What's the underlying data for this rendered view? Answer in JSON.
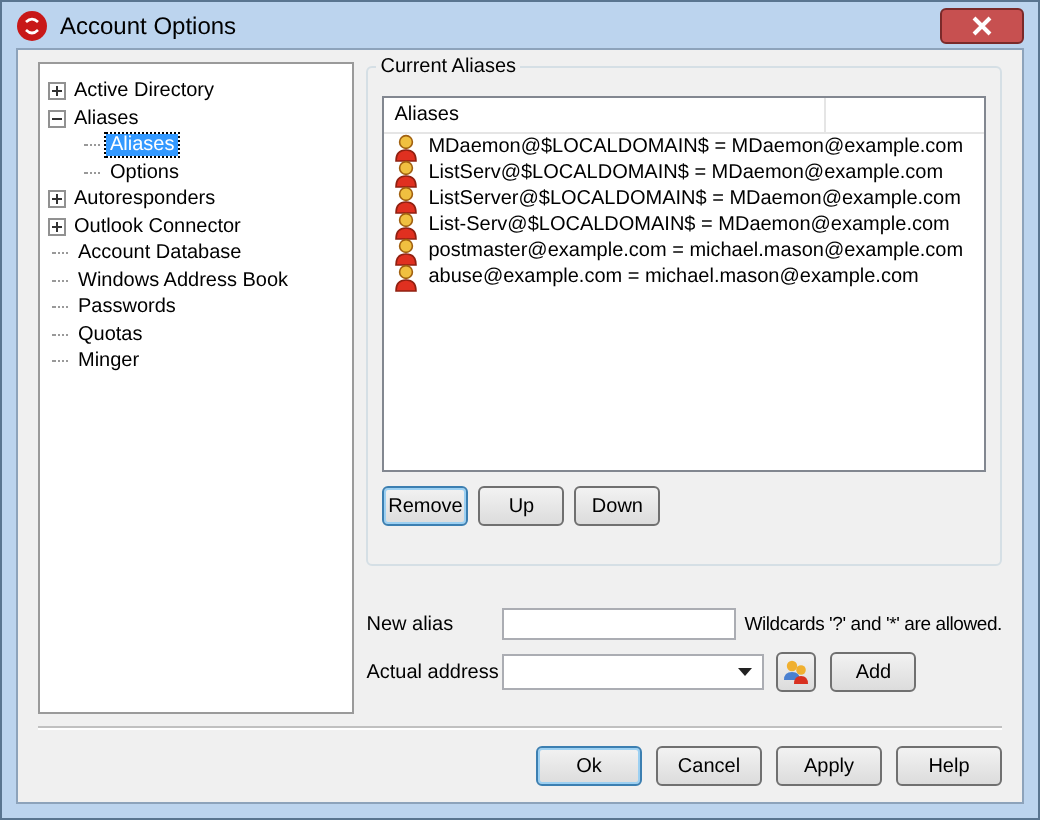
{
  "window": {
    "title": "Account Options"
  },
  "tree": [
    {
      "label": "Active Directory",
      "selected": false,
      "expanded": false
    },
    {
      "label": "Aliases",
      "selected": false,
      "expanded": true,
      "children": [
        {
          "label": "Aliases",
          "selected": true
        },
        {
          "label": "Options",
          "selected": false
        }
      ]
    },
    {
      "label": "Autoresponders",
      "selected": false,
      "expanded": false
    },
    {
      "label": "Outlook Connector",
      "selected": false,
      "expanded": false
    },
    {
      "label": "Account Database",
      "selected": false
    },
    {
      "label": "Windows Address Book",
      "selected": false
    },
    {
      "label": "Passwords",
      "selected": false
    },
    {
      "label": "Quotas",
      "selected": false
    },
    {
      "label": "Minger",
      "selected": false
    }
  ],
  "group": {
    "title": "Current Aliases",
    "column": "Aliases",
    "rows": [
      "MDaemon@$LOCALDOMAIN$ = MDaemon@example.com",
      "ListServ@$LOCALDOMAIN$ = MDaemon@example.com",
      "ListServer@$LOCALDOMAIN$ = MDaemon@example.com",
      "List-Serv@$LOCALDOMAIN$ = MDaemon@example.com",
      "postmaster@example.com = michael.mason@example.com",
      "abuse@example.com = michael.mason@example.com"
    ],
    "buttons": [
      "Remove",
      "Up",
      "Down"
    ]
  },
  "new_alias": {
    "label": "New alias",
    "hint": "Wildcards '?' and '*' are allowed."
  },
  "actual_address": {
    "label": "Actual address",
    "button": "Add"
  },
  "buttons": [
    "Ok",
    "Cancel",
    "Apply",
    "Help"
  ]
}
